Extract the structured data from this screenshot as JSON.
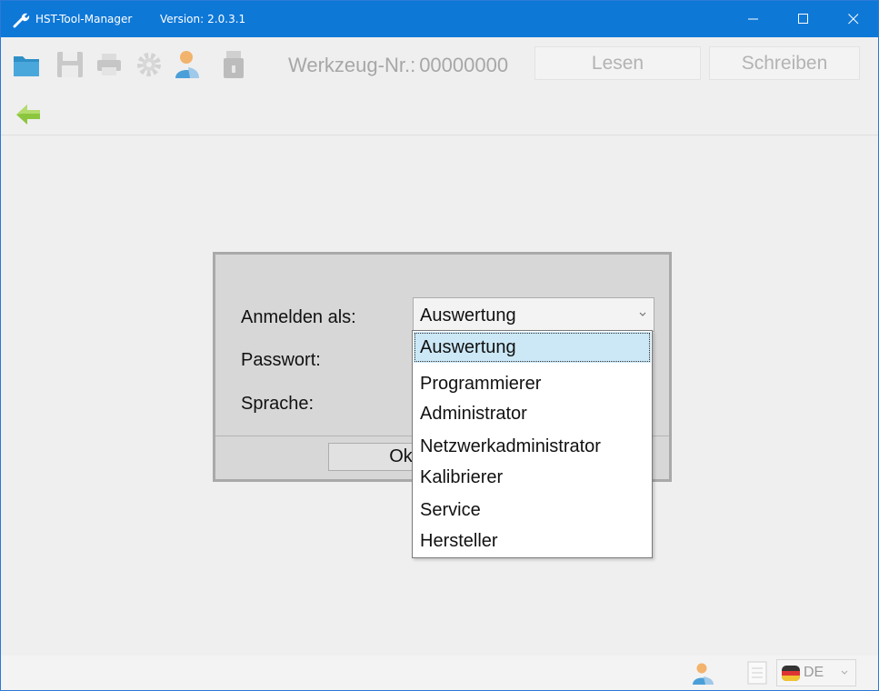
{
  "titlebar": {
    "title": "HST-Tool-Manager",
    "version_label": "Version:",
    "version": "2.0.3.1",
    "color": "#0e78d7"
  },
  "toolbar": {
    "icons": [
      "folder-open-icon",
      "save-icon",
      "print-icon",
      "settings-gear-icon",
      "user-login-icon",
      "usb-drive-icon"
    ],
    "tool_number_label": "Werkzeug-Nr.:",
    "tool_number": "00000000",
    "read_label": "Lesen",
    "write_label": "Schreiben"
  },
  "nav": {
    "back_icon": "back-arrow-icon"
  },
  "login_dialog": {
    "login_as_label": "Anmelden als:",
    "password_label": "Passwort:",
    "language_label": "Sprache:",
    "selected_role": "Auswertung",
    "ok_label": "Ok"
  },
  "role_dropdown": {
    "items": [
      {
        "label": "Auswertung",
        "selected": true
      },
      {
        "label": "Programmierer",
        "selected": false
      },
      {
        "label": "Administrator",
        "selected": false
      },
      {
        "label": "Netzwerkadministrator",
        "selected": false
      },
      {
        "label": "Kalibrierer",
        "selected": false
      },
      {
        "label": "Service",
        "selected": false
      },
      {
        "label": "Hersteller",
        "selected": false
      }
    ],
    "highlight_color": "#cce8f7"
  },
  "statusbar": {
    "language_code": "DE"
  }
}
